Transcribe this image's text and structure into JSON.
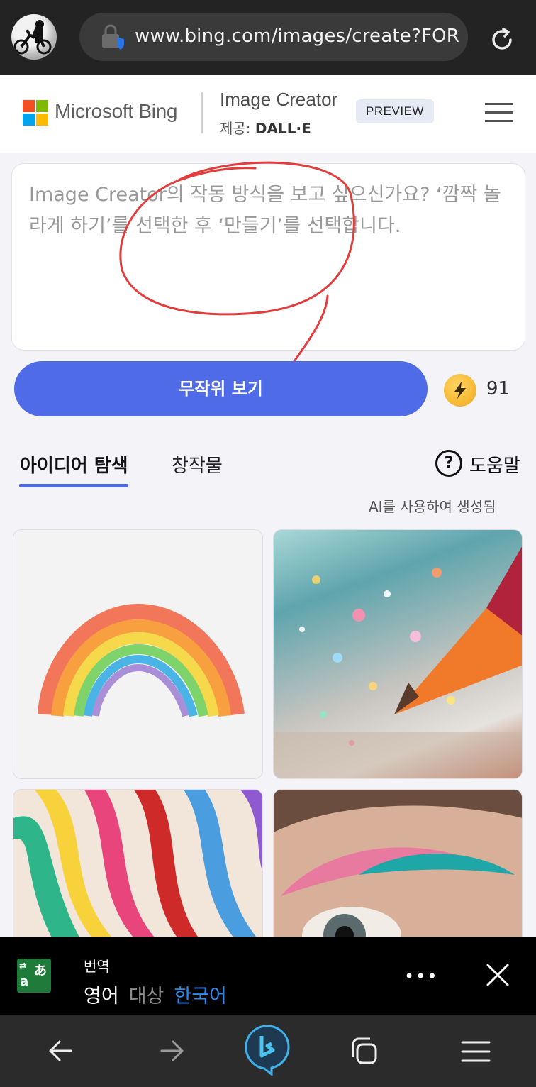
{
  "browser": {
    "url": "www.bing.com/images/create?FORM=",
    "icons": [
      "profile-avatar",
      "lock-shield-icon",
      "reload-icon"
    ]
  },
  "header": {
    "brand": "Microsoft Bing",
    "product": "Image Creator",
    "powered_prefix": "제공:",
    "powered_by": "DALL·E",
    "badge": "PREVIEW",
    "colors": {
      "ms_red": "#f25022",
      "ms_green": "#7fba00",
      "ms_blue": "#00a4ef",
      "ms_yellow": "#ffb900"
    }
  },
  "prompt": {
    "placeholder": "Image Creator의 작동 방식을 보고 싶으신가요? ‘깜짝 놀라게 하기’를 선택한 후 ‘만들기’를 선택합니다."
  },
  "actions": {
    "random_button": "무작위 보기",
    "boosts": "91",
    "accent": "#4f6be8"
  },
  "tabs": {
    "ideas": "아이디어 탐색",
    "creations": "창작물",
    "help": "도움말",
    "help_symbol": "?"
  },
  "ai_note": "AI를 사용하여 생성됨",
  "gallery": [
    "rainbow-paper-image",
    "glitter-pencil-image",
    "colorful-ribbons-image",
    "eye-makeup-image"
  ],
  "translate": {
    "title": "번역",
    "from": "영어",
    "mid": "대상",
    "to": "한국어",
    "more": "•••"
  },
  "nav": [
    "back-icon",
    "forward-icon",
    "bing-icon",
    "tabs-icon",
    "menu-icon"
  ]
}
